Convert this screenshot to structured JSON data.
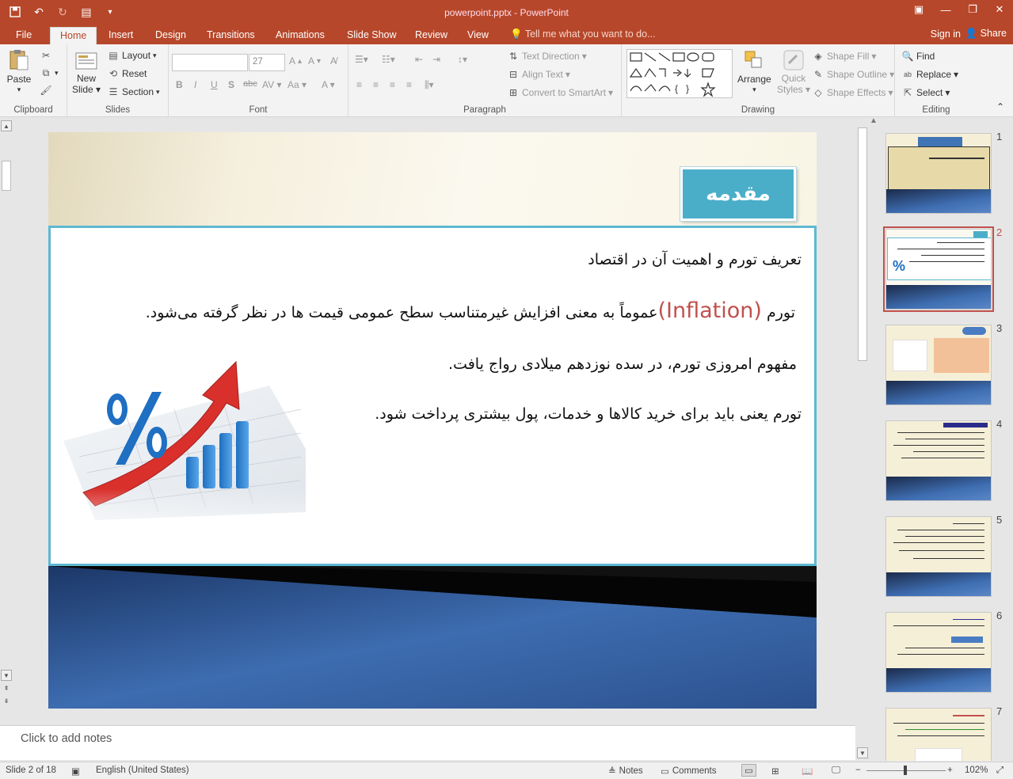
{
  "window": {
    "title": "powerpoint.pptx - PowerPoint",
    "controls": [
      "minimize",
      "restore",
      "close"
    ]
  },
  "quick_access": [
    "save-icon",
    "undo-icon",
    "redo-icon",
    "present-icon",
    "customize-icon"
  ],
  "tabs": [
    "File",
    "Home",
    "Insert",
    "Design",
    "Transitions",
    "Animations",
    "Slide Show",
    "Review",
    "View"
  ],
  "active_tab": "Home",
  "tell_me": "Tell me what you want to do...",
  "sign_in": "Sign in",
  "share": "Share",
  "ribbon": {
    "clipboard": {
      "label": "Clipboard",
      "paste": "Paste"
    },
    "slides": {
      "label": "Slides",
      "new_slide": "New",
      "new_slide2": "Slide",
      "layout": "Layout",
      "reset": "Reset",
      "section": "Section"
    },
    "font": {
      "label": "Font",
      "size": "27"
    },
    "paragraph": {
      "label": "Paragraph",
      "text_direction": "Text Direction",
      "align_text": "Align Text",
      "convert_smartart": "Convert to SmartArt"
    },
    "drawing": {
      "label": "Drawing",
      "arrange": "Arrange",
      "quick_styles": "Quick",
      "quick_styles2": "Styles",
      "shape_fill": "Shape Fill",
      "shape_outline": "Shape Outline",
      "shape_effects": "Shape Effects"
    },
    "editing": {
      "label": "Editing",
      "find": "Find",
      "replace": "Replace",
      "select": "Select"
    }
  },
  "slide": {
    "title": "مقدمه",
    "line1": "تعریف تورم و اهمیت آن در اقتصاد",
    "line2_pre": "تورم ",
    "line2_en": "(Inflation)",
    "line2_post": "عموماً به معنی افزایش غیرمتناسب سطح عمومی قیمت ها در نظر گرفته می‌شود.",
    "line3": "مفهوم امروزی تورم، در سده نوزدهم میلادی رواج یافت.",
    "line4": "تورم یعنی باید برای خرید کالاها و خدمات، پول بیشتری پرداخت شود."
  },
  "thumbnails": [
    {
      "number": "1"
    },
    {
      "number": "2",
      "selected": true
    },
    {
      "number": "3"
    },
    {
      "number": "4"
    },
    {
      "number": "5"
    },
    {
      "number": "6"
    },
    {
      "number": "7"
    }
  ],
  "notes_placeholder": "Click to add notes",
  "status": {
    "slide": "Slide 2 of 18",
    "language": "English (United States)",
    "notes": "Notes",
    "comments": "Comments",
    "zoom": "102%"
  }
}
